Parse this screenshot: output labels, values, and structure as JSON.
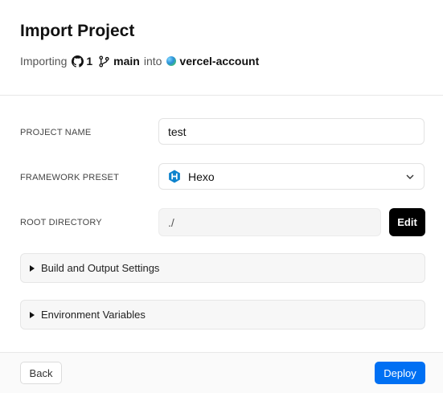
{
  "header": {
    "title": "Import Project",
    "importing_label": "Importing",
    "repo_count": "1",
    "branch": "main",
    "into_label": "into",
    "account": "vercel-account"
  },
  "form": {
    "project_name": {
      "label": "PROJECT NAME",
      "value": "test"
    },
    "framework": {
      "label": "FRAMEWORK PRESET",
      "value": "Hexo",
      "icon": "hexo-icon"
    },
    "root_dir": {
      "label": "ROOT DIRECTORY",
      "value": "./",
      "edit_label": "Edit"
    }
  },
  "sections": {
    "build": "Build and Output Settings",
    "env": "Environment Variables"
  },
  "footer": {
    "back": "Back",
    "deploy": "Deploy"
  },
  "colors": {
    "accent": "#0070f3",
    "hexo": "#0e83cd",
    "dark_button": "#000000"
  }
}
